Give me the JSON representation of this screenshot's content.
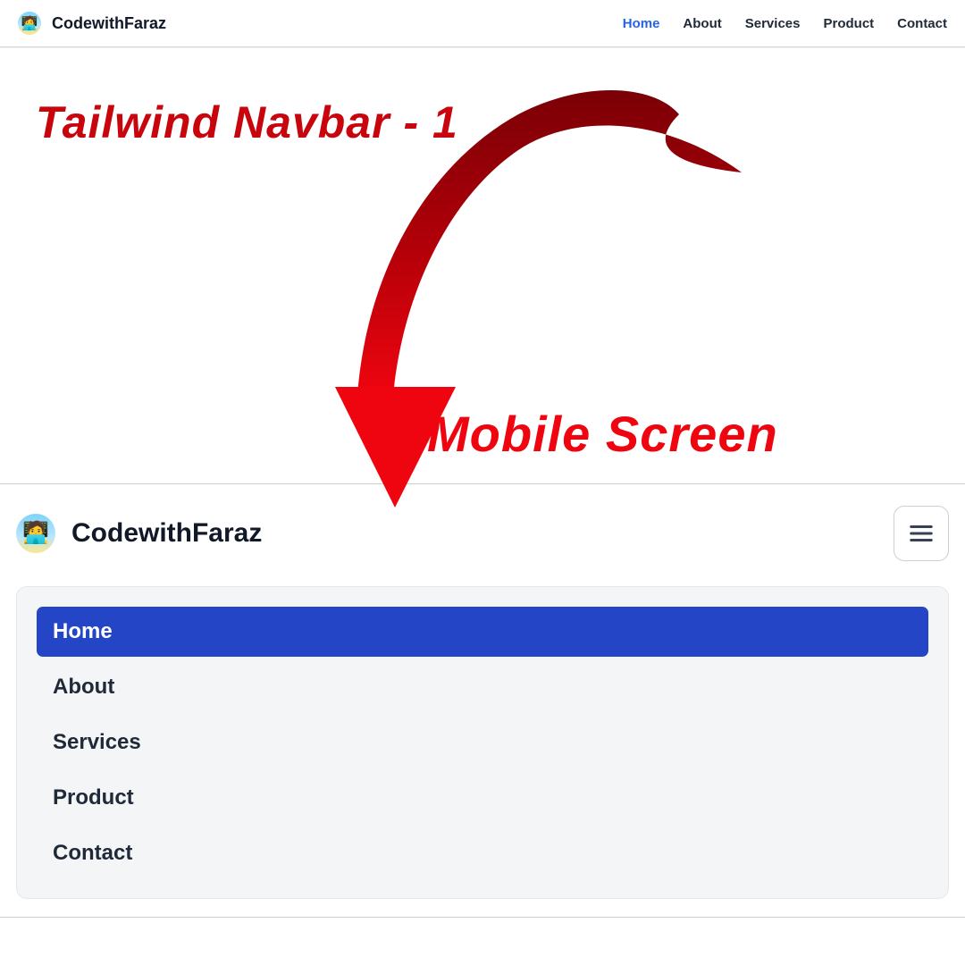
{
  "brand": {
    "name": "CodewithFaraz"
  },
  "nav": {
    "items": [
      {
        "label": "Home",
        "active": true
      },
      {
        "label": "About",
        "active": false
      },
      {
        "label": "Services",
        "active": false
      },
      {
        "label": "Product",
        "active": false
      },
      {
        "label": "Contact",
        "active": false
      }
    ]
  },
  "annotation": {
    "title": "Tailwind Navbar - 1",
    "mobile_label": "Mobile Screen"
  },
  "colors": {
    "accent": "#2563eb",
    "mobile_active_bg": "#2445c6",
    "annotation_red_dark": "#c8040d",
    "annotation_red_bright": "#ef050f"
  }
}
